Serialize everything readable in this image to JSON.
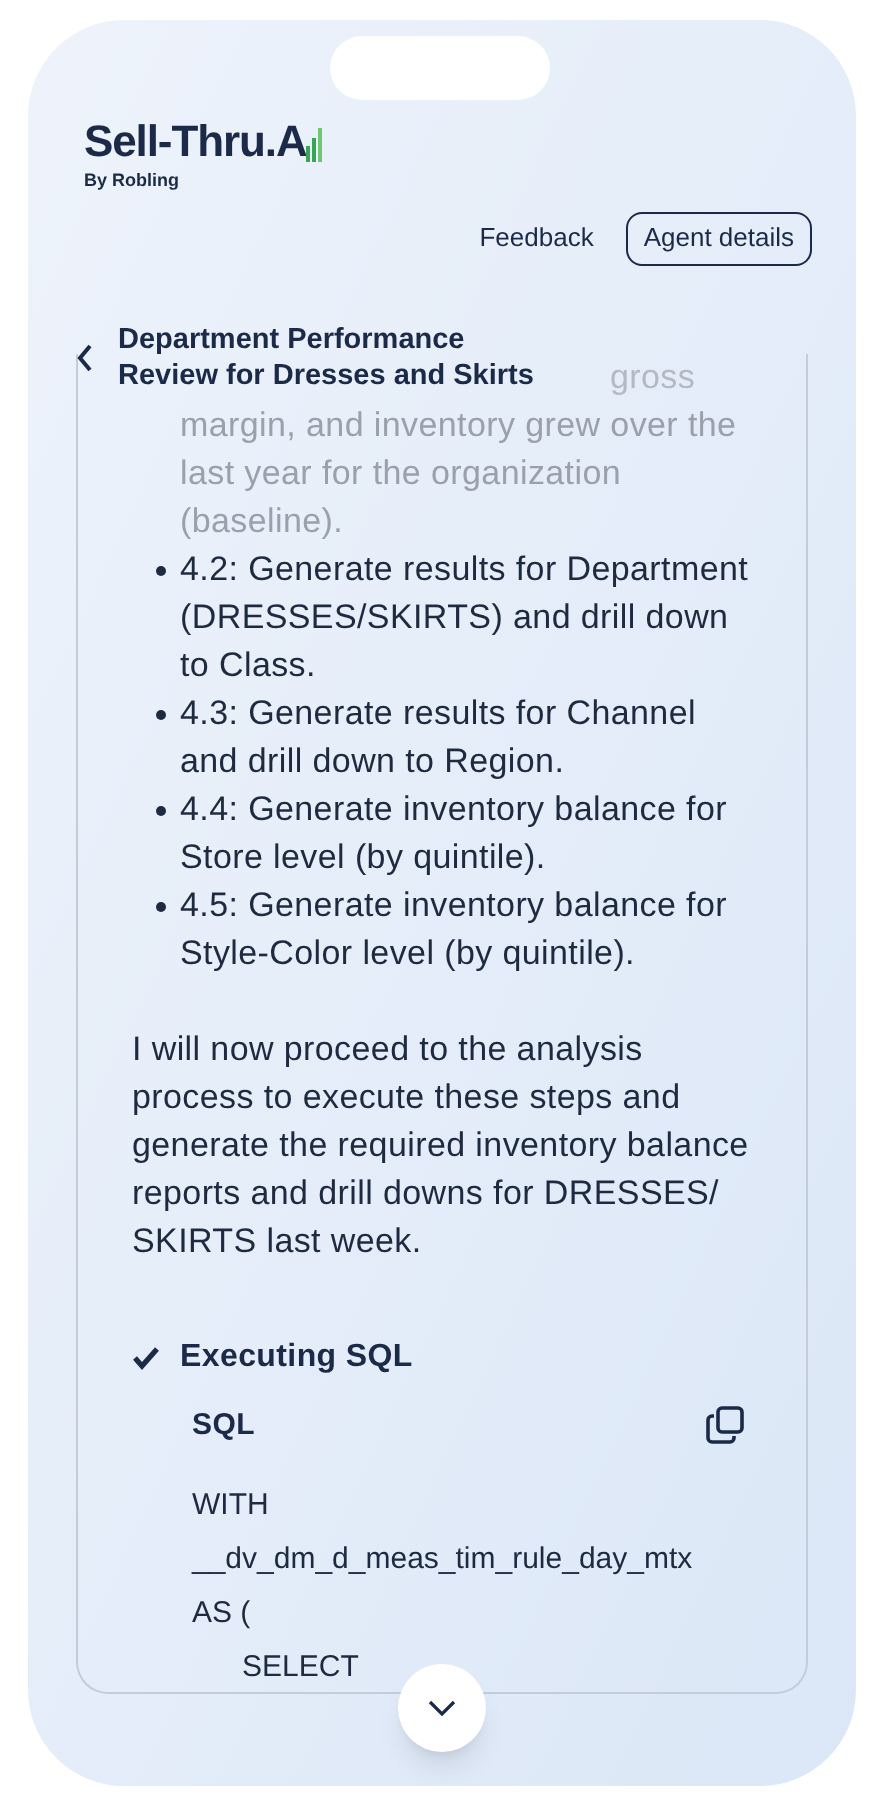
{
  "logo": {
    "name": "Sell-Thru.A",
    "byline": "By Robling"
  },
  "header_actions": [
    {
      "label": "Feedback",
      "kind": "link"
    },
    {
      "label": "Agent details",
      "kind": "outlined"
    }
  ],
  "conversation": {
    "title": "Department Performance Review for Dresses and Skirts"
  },
  "message": {
    "faded_fragment": "gross",
    "faded_text": "margin, and inventory grew over the last year for the organization (baseline).",
    "steps": [
      "4.2: Generate results for Department (DRESSES/SKIRTS) and drill down to Class.",
      "4.3: Generate results for Channel and drill down to Region.",
      "4.4: Generate inventory balance for Store level (by quintile).",
      "4.5: Generate inventory balance for Style-Color level (by quintile)."
    ],
    "paragraph": "I will now proceed to the analysis process to execute these steps and generate the required inventory balance reports and drill downs for DRESSES/ SKIRTS last week.",
    "tool": {
      "label": "Executing SQL",
      "done": true,
      "block_title": "SQL",
      "code_lines": [
        {
          "text": "WITH",
          "indented": false
        },
        {
          "text": "__dv_dm_d_meas_tim_rule_day_mtx",
          "indented": false
        },
        {
          "text": "AS (",
          "indented": false
        },
        {
          "text": "SELECT",
          "indented": true
        }
      ]
    }
  }
}
